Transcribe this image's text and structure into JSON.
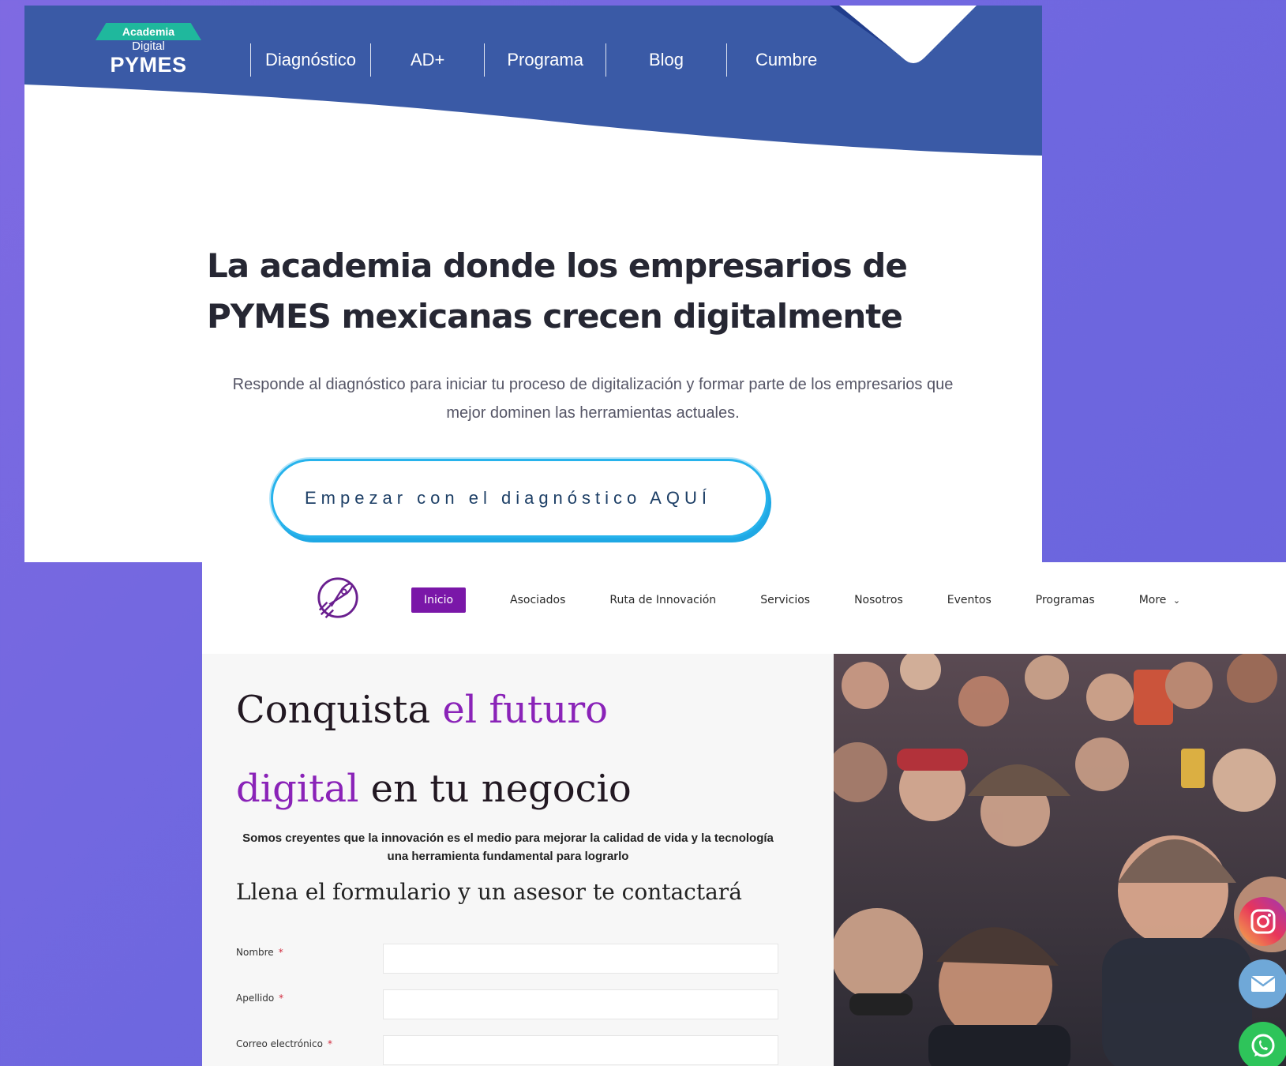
{
  "academia": {
    "logo": {
      "tab_text": "Academia",
      "line2": "Digital",
      "line3": "PYMES"
    },
    "nav": [
      "Diagnóstico",
      "AD+",
      "Programa",
      "Blog",
      "Cumbre"
    ],
    "headline": "La academia donde los empresarios de PYMES mexicanas crecen digitalmente",
    "subtext": "Responde al diagnóstico para iniciar tu proceso de digitalización y formar parte de los empresarios que mejor dominen las herramientas actuales.",
    "cta": "Empezar con el diagnóstico AQUÍ",
    "colors": {
      "header_blue": "#3a5aa6",
      "cta_border": "#27b3ec",
      "logo_green": "#1fb89d"
    }
  },
  "innovacion": {
    "nav": {
      "active": "Inicio",
      "items": [
        "Asociados",
        "Ruta de Innovación",
        "Servicios",
        "Nosotros",
        "Eventos",
        "Programas"
      ],
      "more": "More"
    },
    "title": {
      "part1": "Conquista ",
      "accent1": "el futuro",
      "accent2": "digital",
      "part2": " en tu negocio"
    },
    "lead": "Somos creyentes que la innovación es el medio para mejorar la calidad de vida y la tecnología una herramienta fundamental para lograrlo",
    "form_title": "Llena el formulario y un asesor te contactará",
    "fields": [
      {
        "label": "Nombre",
        "required": "*"
      },
      {
        "label": "Apellido",
        "required": "*"
      },
      {
        "label": "Correo electrónico",
        "required": "*"
      }
    ],
    "colors": {
      "accent_purple": "#8a23b8",
      "active_nav": "#7a17a8"
    }
  },
  "social": [
    "instagram-icon",
    "mail-icon",
    "whatsapp-icon"
  ]
}
